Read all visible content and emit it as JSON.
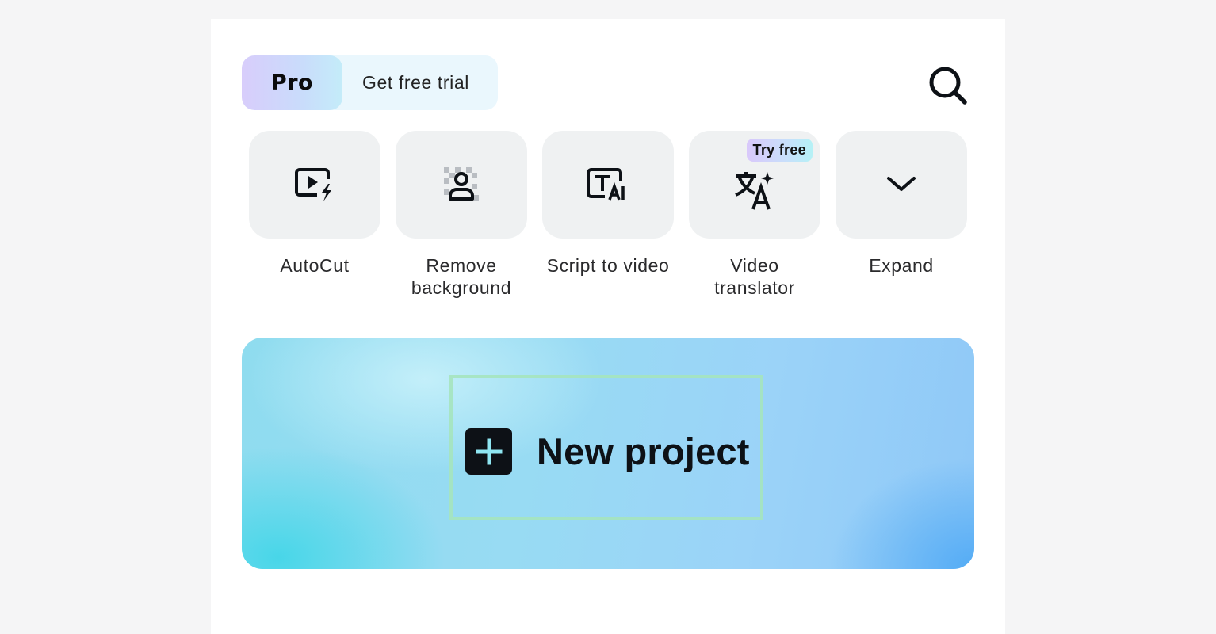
{
  "header": {
    "pro_label": "Pro",
    "trial_label": "Get free trial",
    "search_icon": "search-icon"
  },
  "tools": [
    {
      "label_line1": "AutoCut",
      "label_line2": "",
      "icon": "autocut-icon"
    },
    {
      "label_line1": "Remove",
      "label_line2": "background",
      "icon": "remove-background-icon"
    },
    {
      "label_line1": "Script to video",
      "label_line2": "",
      "icon": "script-to-video-icon"
    },
    {
      "label_line1": "Video",
      "label_line2": "translator",
      "icon": "translate-icon",
      "badge": "Try free"
    },
    {
      "label_line1": "Expand",
      "label_line2": "",
      "icon": "chevron-down-icon"
    }
  ],
  "new_project": {
    "label": "New project",
    "icon": "plus-icon"
  },
  "colors": {
    "page_bg": "#f5f5f6",
    "panel_bg": "#ffffff",
    "tile_bg": "#eff1f2",
    "text_dark": "#0d1116",
    "highlight": "#a5e4be"
  }
}
